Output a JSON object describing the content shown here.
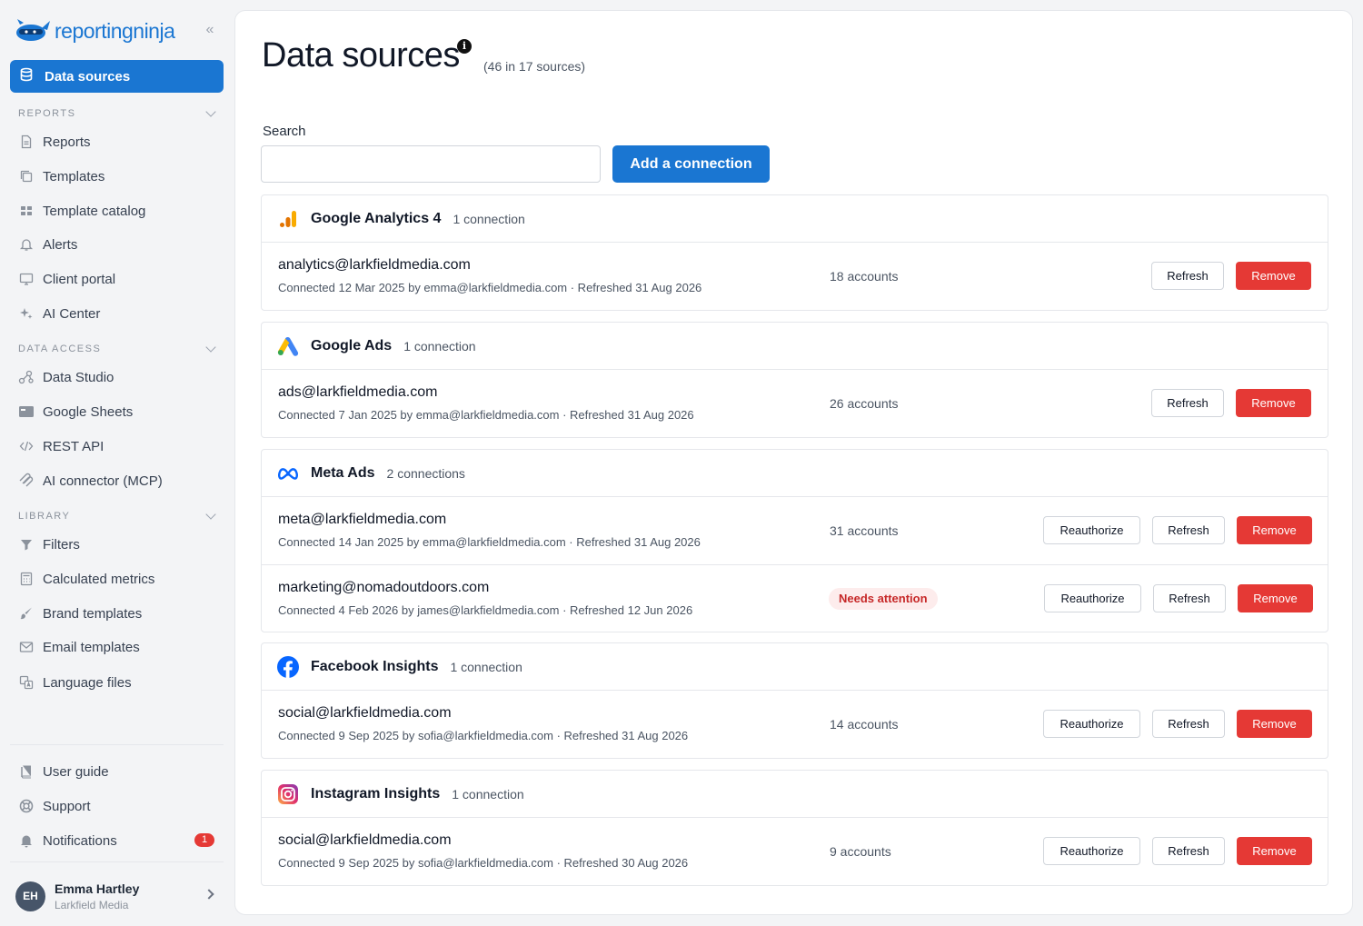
{
  "app": {
    "logo_prefix": "reporting",
    "logo_suffix": "ninja",
    "collapse_glyph": "«"
  },
  "sidebar": {
    "active_item": "Data sources",
    "sections": {
      "reports": "REPORTS",
      "data_access": "DATA ACCESS",
      "library": "LIBRARY"
    },
    "reports_items": [
      {
        "label": "Reports",
        "icon": "document-icon"
      },
      {
        "label": "Templates",
        "icon": "copy-icon"
      },
      {
        "label": "Template catalog",
        "icon": "grid-icon"
      },
      {
        "label": "Alerts",
        "icon": "bell-icon"
      },
      {
        "label": "Client portal",
        "icon": "monitor-icon"
      },
      {
        "label": "AI Center",
        "icon": "sparkle-icon"
      }
    ],
    "data_access_items": [
      {
        "label": "Data Studio",
        "icon": "nodes-icon"
      },
      {
        "label": "Google Sheets",
        "icon": "sheet-icon"
      },
      {
        "label": "REST API",
        "icon": "code-icon"
      },
      {
        "label": "AI connector (MCP)",
        "icon": "mcp-icon"
      }
    ],
    "library_items": [
      {
        "label": "Filters",
        "icon": "filter-icon"
      },
      {
        "label": "Calculated metrics",
        "icon": "calculator-icon"
      },
      {
        "label": "Brand templates",
        "icon": "brush-icon"
      },
      {
        "label": "Email templates",
        "icon": "mail-icon"
      },
      {
        "label": "Language files",
        "icon": "language-icon"
      }
    ],
    "bottom_items": [
      {
        "label": "User guide",
        "icon": "book-icon"
      },
      {
        "label": "Support",
        "icon": "lifebuoy-icon"
      },
      {
        "label": "Notifications",
        "icon": "bell-solid-icon",
        "badge": "1"
      }
    ],
    "user": {
      "initials": "EH",
      "name": "Emma Hartley",
      "org": "Larkfield Media"
    }
  },
  "main": {
    "title": "Data sources",
    "info_glyph": "i",
    "subtitle": "(46 in 17 sources)",
    "search_label": "Search",
    "search_value": "",
    "add_button": "Add a connection",
    "buttons": {
      "reauthorize": "Reauthorize",
      "refresh": "Refresh",
      "remove": "Remove"
    },
    "sources": [
      {
        "name": "Google Analytics 4",
        "count": "1 connection",
        "icon": "google-analytics-icon",
        "connections": [
          {
            "email": "analytics@larkfieldmedia.com",
            "meta": "Connected 12 Mar 2025 by emma@larkfieldmedia.com · Refreshed 31 Aug 2026",
            "accounts": "18 accounts",
            "reauthorize": false
          }
        ]
      },
      {
        "name": "Google Ads",
        "count": "1 connection",
        "icon": "google-ads-icon",
        "connections": [
          {
            "email": "ads@larkfieldmedia.com",
            "meta": "Connected 7 Jan 2025 by emma@larkfieldmedia.com · Refreshed 31 Aug 2026",
            "accounts": "26 accounts",
            "reauthorize": false
          }
        ]
      },
      {
        "name": "Meta Ads",
        "count": "2 connections",
        "icon": "meta-icon",
        "connections": [
          {
            "email": "meta@larkfieldmedia.com",
            "meta": "Connected 14 Jan 2025 by emma@larkfieldmedia.com · Refreshed 31 Aug 2026",
            "accounts": "31 accounts",
            "reauthorize": true
          },
          {
            "email": "marketing@nomadoutdoors.com",
            "meta": "Connected 4 Feb 2026 by james@larkfieldmedia.com · Refreshed 12 Jun 2026",
            "status": "Needs attention",
            "reauthorize": true
          }
        ]
      },
      {
        "name": "Facebook Insights",
        "count": "1 connection",
        "icon": "facebook-icon",
        "connections": [
          {
            "email": "social@larkfieldmedia.com",
            "meta": "Connected 9 Sep 2025 by sofia@larkfieldmedia.com · Refreshed 31 Aug 2026",
            "accounts": "14 accounts",
            "reauthorize": true
          }
        ]
      },
      {
        "name": "Instagram Insights",
        "count": "1 connection",
        "icon": "instagram-icon",
        "connections": [
          {
            "email": "social@larkfieldmedia.com",
            "meta": "Connected 9 Sep 2025 by sofia@larkfieldmedia.com · Refreshed 30 Aug 2026",
            "accounts": "9 accounts",
            "reauthorize": true
          }
        ]
      }
    ]
  },
  "colors": {
    "accent": "#1a76d2",
    "danger": "#e53935",
    "attention_bg": "#fdecec",
    "attention_text": "#c62828"
  }
}
